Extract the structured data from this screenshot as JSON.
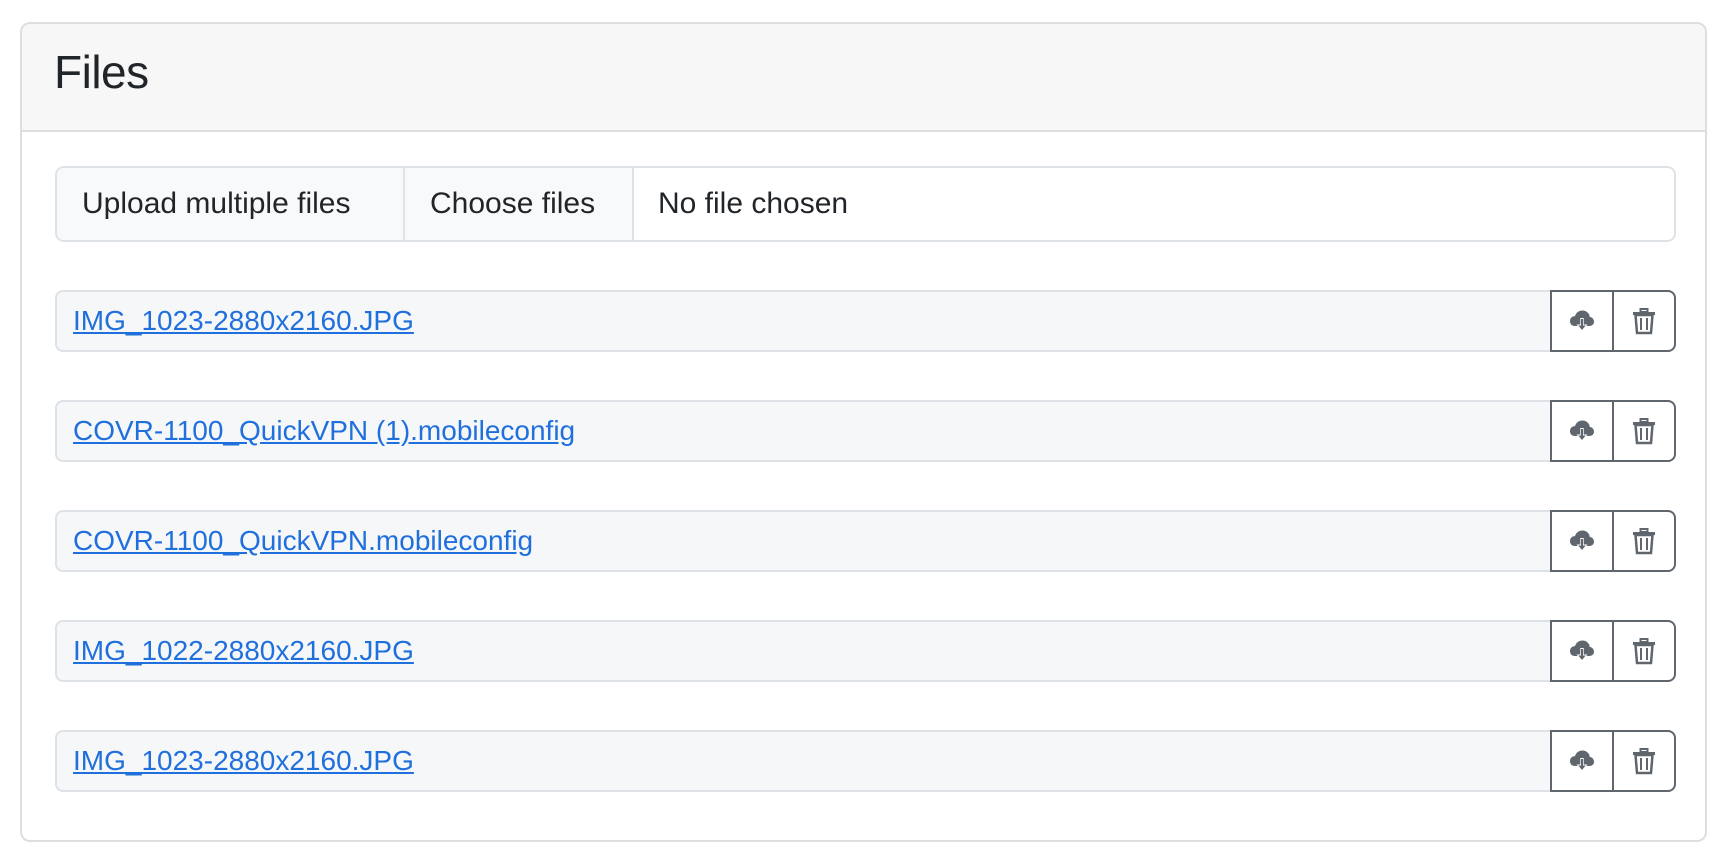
{
  "card": {
    "title": "Files"
  },
  "upload": {
    "label": "Upload multiple files",
    "choose_button": "Choose files",
    "status": "No file chosen"
  },
  "files": [
    {
      "name": "IMG_1023-2880x2160.JPG"
    },
    {
      "name": "COVR-1100_QuickVPN (1).mobileconfig"
    },
    {
      "name": "COVR-1100_QuickVPN.mobileconfig"
    },
    {
      "name": "IMG_1022-2880x2160.JPG"
    },
    {
      "name": "IMG_1023-2880x2160.JPG"
    }
  ],
  "icons": {
    "download": "cloud-download-icon",
    "delete": "trash-icon"
  },
  "colors": {
    "link": "#1f6fdc",
    "icon": "#5f666d",
    "border": "#dee2e6",
    "header_bg": "#f7f7f8"
  }
}
